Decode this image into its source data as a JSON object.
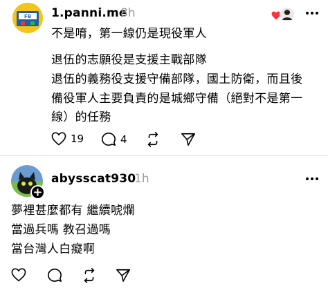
{
  "post1": {
    "username": "1.panni.me",
    "time": "8h",
    "lines": [
      "不是唷，第一線仍是現役軍人",
      "",
      "退伍的志願役是支援主戰部隊",
      "退伍的義務役支援守備部隊，國土防衛，而且後",
      "備役軍人主要負責的是城鄉守備（絕對不是第一",
      "線）的任務"
    ],
    "likes": "19",
    "replies": "4",
    "avatar_text": "FB"
  },
  "post2": {
    "username": "abysscat930",
    "time": "1h",
    "lines": [
      "夢裡甚麼都有 繼續唬爛",
      "當過兵嗎 教召過嗎",
      "當台灣人白癡啊"
    ]
  },
  "colors": {
    "heart": "#ff3040",
    "muted": "#9b9b9b",
    "divider": "#e4e4e4"
  }
}
